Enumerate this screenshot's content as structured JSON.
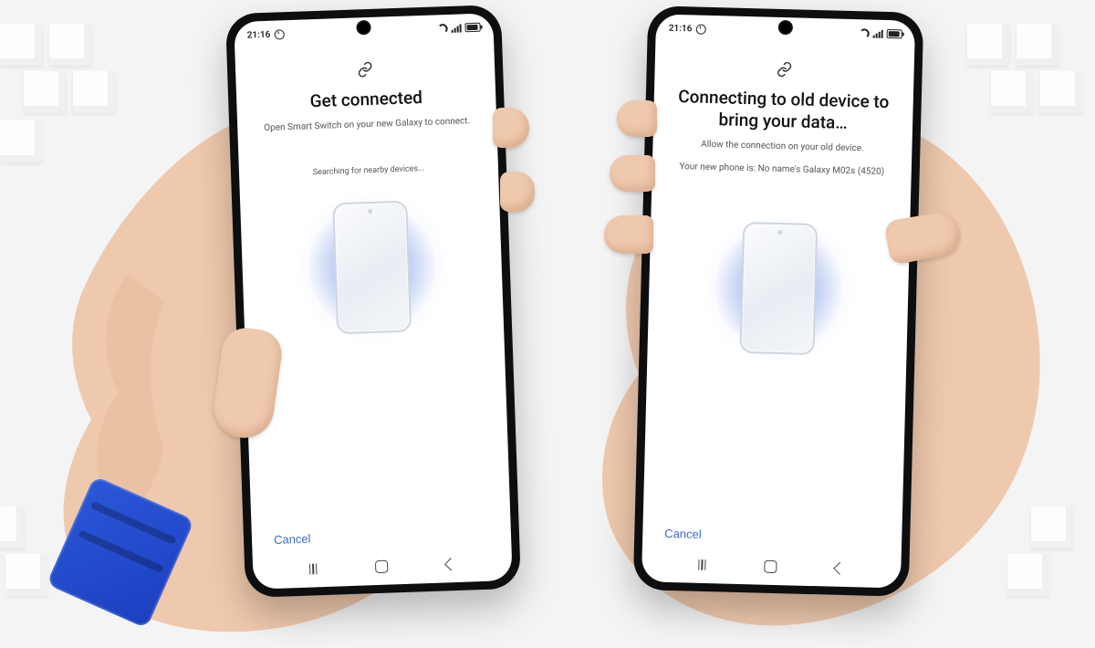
{
  "status": {
    "time": "21:16"
  },
  "left_phone": {
    "title": "Get connected",
    "subtitle": "Open Smart Switch on your new Galaxy to connect.",
    "status_text": "Searching for nearby devices...",
    "cancel": "Cancel"
  },
  "right_phone": {
    "title": "Connecting to old device to bring your data…",
    "subtitle": "Allow the connection on your old device.",
    "device_line": "Your new phone is: No name's Galaxy M02s (4520)",
    "cancel": "Cancel"
  },
  "colors": {
    "accent": "#3a6bcf"
  }
}
